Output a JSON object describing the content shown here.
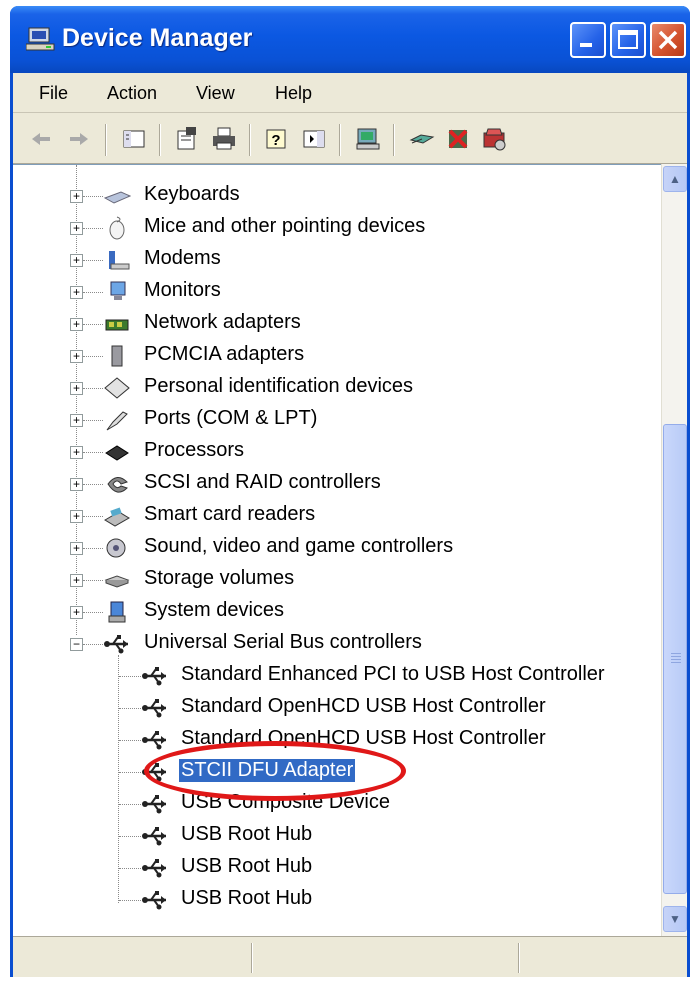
{
  "window": {
    "title": "Device Manager"
  },
  "menu": [
    "File",
    "Action",
    "View",
    "Help"
  ],
  "toolbar_icons": [
    "back-icon",
    "forward-icon",
    "console-tree-icon",
    "properties-icon",
    "print-icon",
    "help-icon",
    "show-hide-action-pane-icon",
    "scan-hardware-icon",
    "update-driver-icon",
    "uninstall-icon",
    "disable-icon"
  ],
  "tree": {
    "categories": [
      {
        "label": "Keyboards",
        "icon": "keyboard-icon"
      },
      {
        "label": "Mice and other pointing devices",
        "icon": "mouse-icon"
      },
      {
        "label": "Modems",
        "icon": "modem-icon"
      },
      {
        "label": "Monitors",
        "icon": "monitor-icon"
      },
      {
        "label": "Network adapters",
        "icon": "network-adapter-icon"
      },
      {
        "label": "PCMCIA adapters",
        "icon": "pcmcia-icon"
      },
      {
        "label": "Personal identification devices",
        "icon": "personal-id-icon"
      },
      {
        "label": "Ports (COM & LPT)",
        "icon": "port-icon"
      },
      {
        "label": "Processors",
        "icon": "processor-icon"
      },
      {
        "label": "SCSI and RAID controllers",
        "icon": "scsi-icon"
      },
      {
        "label": "Smart card readers",
        "icon": "smart-card-icon"
      },
      {
        "label": "Sound, video and game controllers",
        "icon": "sound-icon"
      },
      {
        "label": "Storage volumes",
        "icon": "storage-icon"
      },
      {
        "label": "System devices",
        "icon": "system-icon"
      },
      {
        "label": "Universal Serial Bus controllers",
        "icon": "usb-icon",
        "expanded": true
      }
    ],
    "usb_children": [
      {
        "label": "Standard Enhanced PCI to USB Host Controller"
      },
      {
        "label": "Standard OpenHCD USB Host Controller"
      },
      {
        "label": "Standard OpenHCD USB Host Controller"
      },
      {
        "label": "STCII DFU Adapter",
        "selected": true
      },
      {
        "label": "USB Composite Device"
      },
      {
        "label": "USB Root Hub"
      },
      {
        "label": "USB Root Hub"
      },
      {
        "label": "USB Root Hub"
      }
    ]
  },
  "colors": {
    "title_bar": "#0b58e2",
    "selection": "#316ac5",
    "annotation_circle": "#e01818"
  }
}
